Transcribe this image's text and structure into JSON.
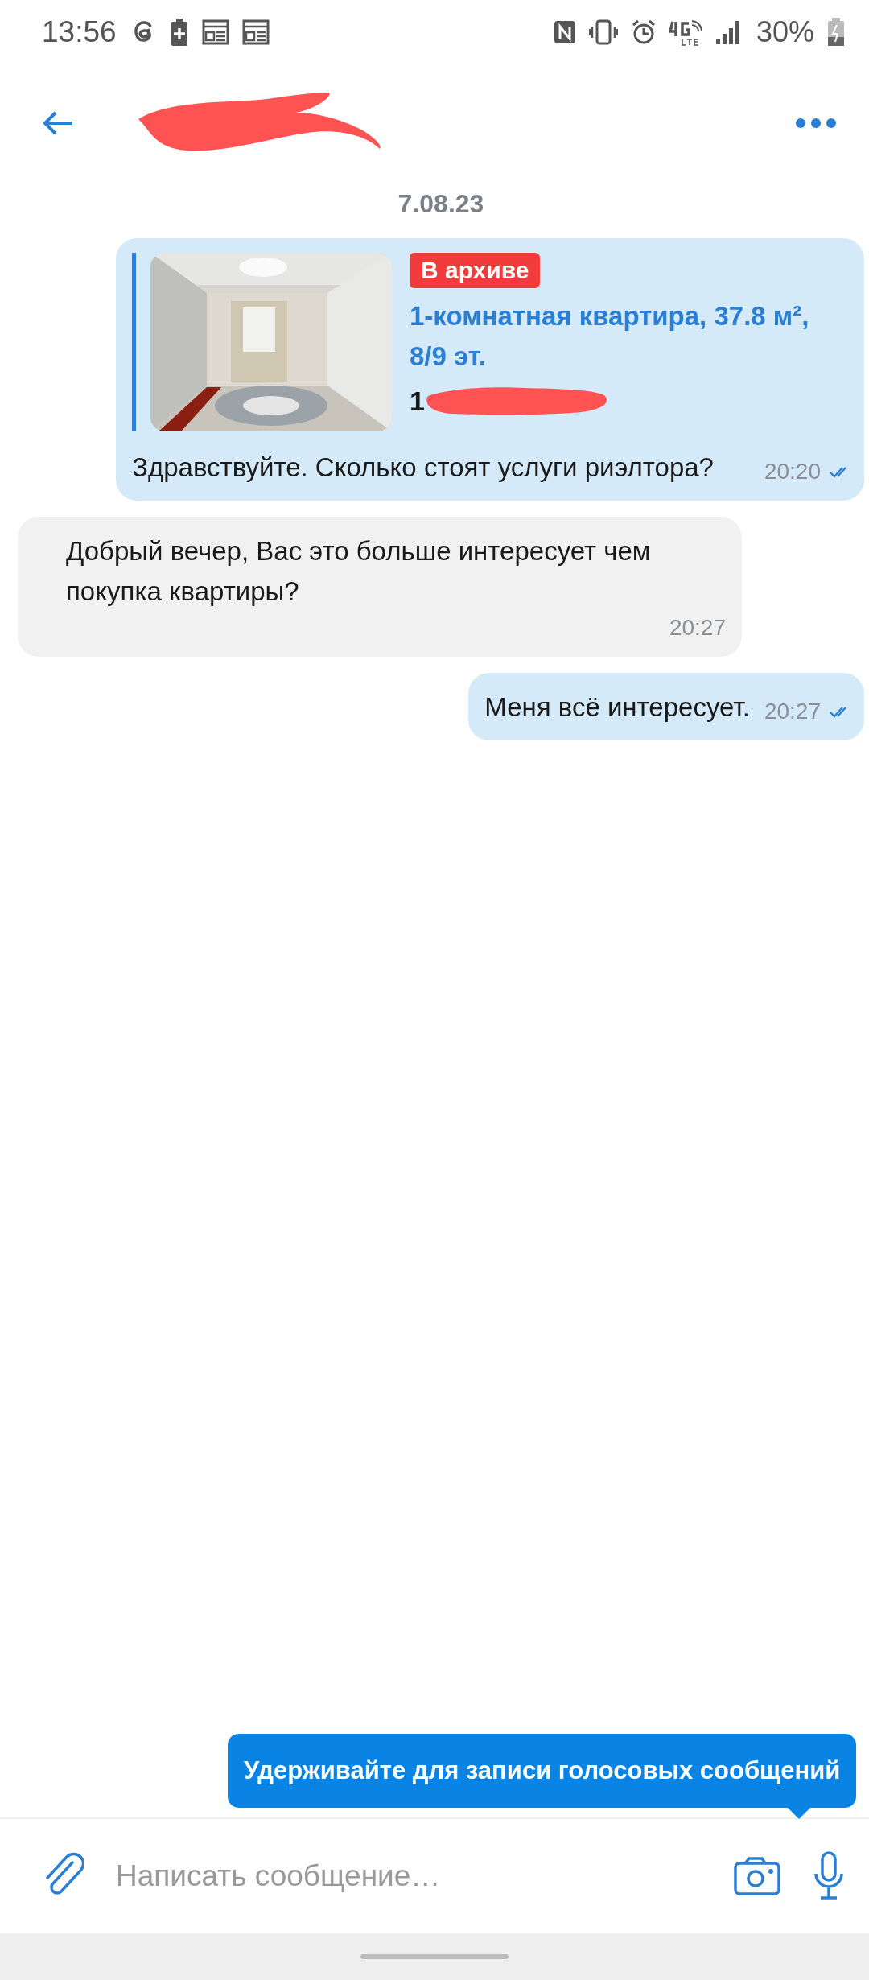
{
  "status_bar": {
    "time": "13:56",
    "battery": "30%"
  },
  "date": "7.08.23",
  "messages": [
    {
      "kind": "listing",
      "outgoing": true,
      "listing": {
        "badge": "В архиве",
        "title": "1-комнатная квартира, 37.8 м², 8/9 эт.",
        "price": "1"
      },
      "text": "Здравствуйте. Сколько стоят услуги риэлтора?",
      "time": "20:20",
      "read": true
    },
    {
      "kind": "text",
      "outgoing": false,
      "text": "Добрый вечер, Вас это больше интересует чем покупка квартиры?",
      "time": "20:27"
    },
    {
      "kind": "text",
      "outgoing": true,
      "text": "Меня всё интересует.",
      "time": "20:27",
      "read": true
    }
  ],
  "tooltip": "Удерживайте для записи голосовых сообщений",
  "composer": {
    "placeholder": "Написать сообщение…"
  }
}
